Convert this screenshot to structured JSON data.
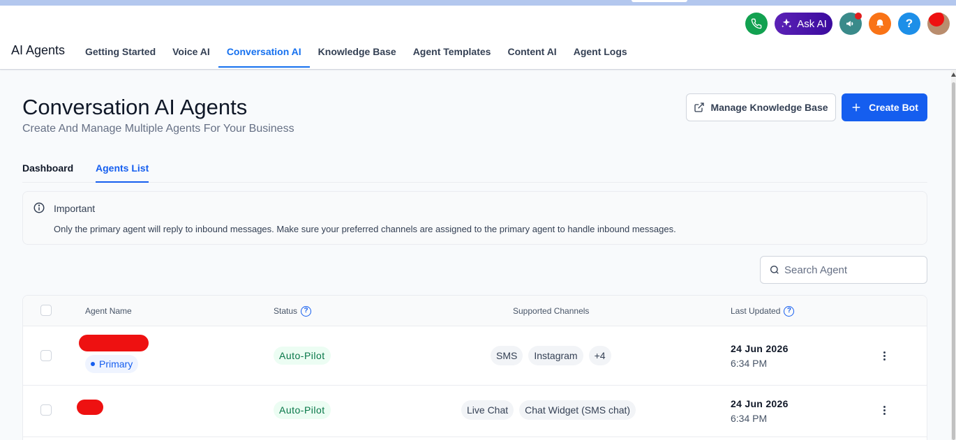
{
  "app": {
    "title": "AI Agents"
  },
  "nav": {
    "items": [
      {
        "label": "Getting Started"
      },
      {
        "label": "Voice AI"
      },
      {
        "label": "Conversation AI",
        "active": true
      },
      {
        "label": "Knowledge Base"
      },
      {
        "label": "Agent Templates"
      },
      {
        "label": "Content AI"
      },
      {
        "label": "Agent Logs"
      }
    ]
  },
  "topbar": {
    "ask_ai_label": "Ask AI",
    "icons": [
      "phone-icon",
      "sparkle-icon",
      "megaphone-icon",
      "bell-icon",
      "help-icon",
      "avatar"
    ],
    "colors": {
      "phone": "#12a150",
      "ask_ai": "#4c1d95",
      "megaphone": "#3a8a8a",
      "bell": "#f97316",
      "help": "#1d8fe8"
    }
  },
  "page": {
    "title": "Conversation AI Agents",
    "subtitle": "Create And Manage Multiple Agents For Your Business",
    "manage_kb_label": "Manage Knowledge Base",
    "create_bot_label": "Create Bot"
  },
  "subtabs": [
    {
      "label": "Dashboard"
    },
    {
      "label": "Agents List",
      "active": true
    }
  ],
  "alert": {
    "title": "Important",
    "body": "Only the primary agent will reply to inbound messages. Make sure your preferred channels are assigned to the primary agent to handle inbound messages."
  },
  "search": {
    "placeholder": "Search Agent",
    "value": ""
  },
  "table": {
    "columns": {
      "agent_name": "Agent Name",
      "status": "Status",
      "channels": "Supported Channels",
      "last_updated": "Last Updated"
    },
    "rows": [
      {
        "badge": "Primary",
        "status": "Auto-Pilot",
        "channels": [
          "SMS",
          "Instagram",
          "+4"
        ],
        "date": "24 Jun 2026",
        "time": "6:34 PM"
      },
      {
        "status": "Auto-Pilot",
        "channels": [
          "Live Chat",
          "Chat Widget (SMS chat)"
        ],
        "date": "24 Jun 2026",
        "time": "6:34 PM"
      }
    ]
  },
  "colors": {
    "accent": "#155eef",
    "status_green": "#067647",
    "redaction": "#ee1111"
  }
}
